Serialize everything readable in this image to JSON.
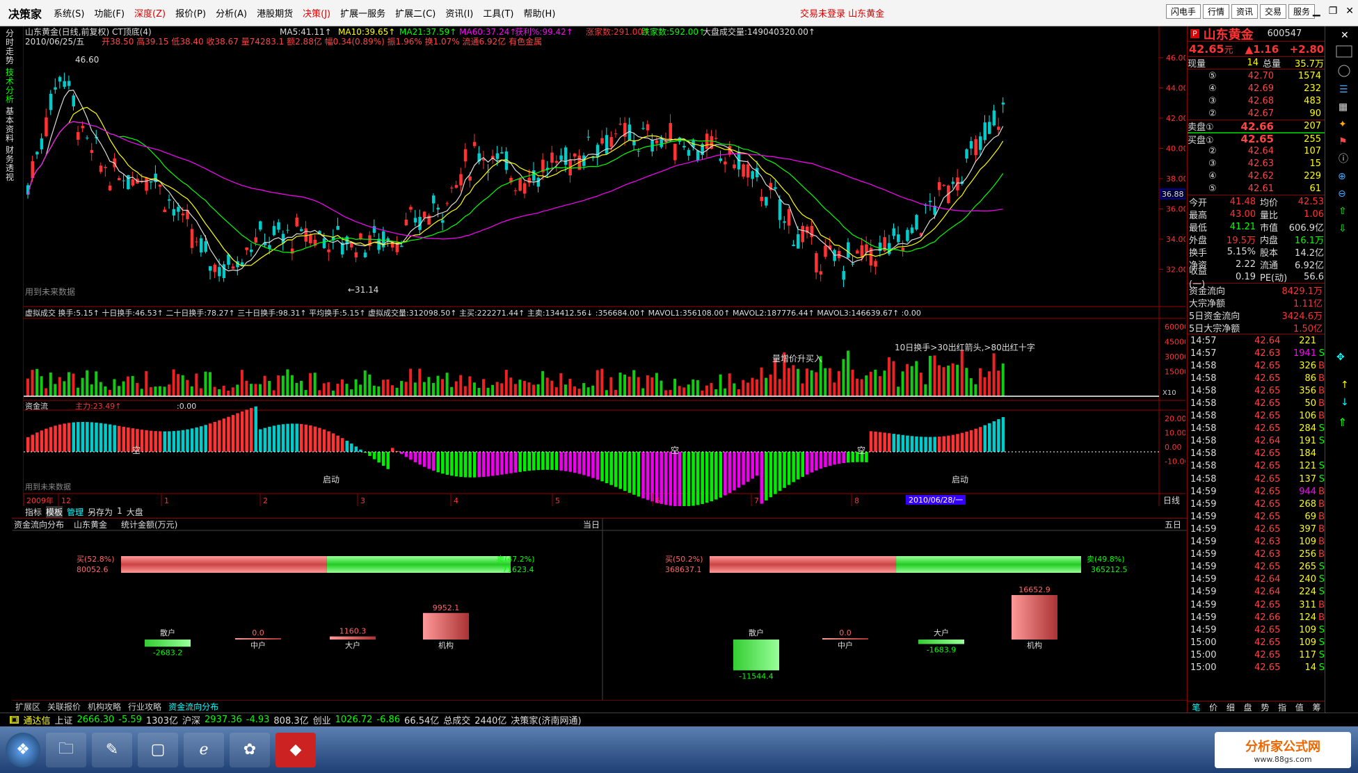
{
  "app": {
    "logo": "决策家",
    "menus": [
      "系统(S)",
      "功能(F)",
      "深度(Z)",
      "报价(P)",
      "分析(A)",
      "港股期货",
      "决策(J)",
      "扩展一服务",
      "扩展二(C)",
      "资讯(I)",
      "工具(T)",
      "帮助(H)"
    ],
    "login": "交易未登录  山东黄金",
    "top_buttons": [
      "闪电手",
      "行情",
      "资讯",
      "交易",
      "服务"
    ]
  },
  "left_tabs": [
    "分时走势",
    "技术分析",
    "基本资料",
    "财务透视"
  ],
  "main": {
    "title": "山东黄金(日线,前复权) CT顶底(4)",
    "date": "2010/06/25/五",
    "ohlc": "开38.50 高39.15 低38.40 收38.67 量74283.1 额2.88亿 幅0.34(0.89%) 振1.96% 换1.07% 流通6.92亿 有色金属",
    "ma5": "MA5:41.11↑",
    "ma10": "MA10:39.65↑",
    "ma21": "MA21:37.59↑",
    "ma60": "MA60:37.24↑",
    "profit": "获利%:99.42↑",
    "up": "涨家数:291.00↑",
    "down": "跌家数:592.00↑",
    "bigvol": "大盘成交量:149040320.00↑",
    "high_label": "46.60",
    "low_label": "←31.14",
    "future_note": "用到未来数据",
    "rsnote1": "36.88",
    "price_ticks": [
      "46.00",
      "44.00",
      "42.00",
      "40.00",
      "38.00",
      "36.00",
      "34.00",
      "32.00"
    ],
    "vol_line": "虚拟成交  换手:5.15↑  十日换手:46.53↑  二十日换手:78.27↑  三十日换手:98.31↑  平均换手:5.15↑  虚拟成交量:312098.50↑  主买:222271.44↑  主卖:134412.56↓  :356684.00↑  MAVOL1:356108.00↑  MAVOL2:187776.44↑  MAVOL3:146639.67↑  :0.00",
    "vol_note": "10日换手>30出红箭头,>80出红十字",
    "vol_note2": "量增价升买入",
    "vol_ticks": [
      "60000",
      "45000",
      "30000",
      "15000"
    ],
    "vol_x": "X10",
    "flow_title": "资金流",
    "flow_main": "主力:23.49↑",
    "flow_zero": ":0.00",
    "flow_ticks": [
      "20.00",
      "10.00",
      "0.00",
      "-10.00"
    ],
    "flow_labels": [
      "空",
      "空",
      "空",
      "启动",
      "启动"
    ],
    "xaxis": [
      "2009年",
      "12",
      "1",
      "2",
      "3",
      "4",
      "5",
      "6",
      "7",
      "8"
    ],
    "xaxis_date": "2010/06/28/一",
    "period": "日线",
    "bottom_tabs": [
      "指标",
      "模板",
      "管理",
      "另存为",
      "1",
      "大盘"
    ]
  },
  "flow_dist": {
    "title": "资金流向分布",
    "stock": "山东黄金",
    "unit": "统计金额(万元)",
    "today": "当日",
    "five": "五日",
    "today_buy_pct": "买(52.8%)",
    "today_buy": "80052.6",
    "today_sell_pct": "卖(47.2%)",
    "today_sell": "71623.4",
    "five_buy_pct": "买(50.2%)",
    "five_buy": "368637.1",
    "five_sell_pct": "卖(49.8%)",
    "five_sell": "365212.5",
    "cats": [
      "散户",
      "中户",
      "大户",
      "机构"
    ],
    "today_vals": [
      -2683.2,
      0.0,
      1160.3,
      9952.1
    ],
    "today_labels": [
      "-2683.2",
      "0.0",
      "1160.3",
      "9952.1"
    ],
    "five_vals": [
      -11544.4,
      0.0,
      -1683.9,
      16652.9
    ],
    "five_labels": [
      "-11544.4",
      "0.0",
      "-1683.9",
      "16652.9"
    ]
  },
  "bottom_links": [
    "扩展区",
    "关联报价",
    "机构攻略",
    "行业攻略",
    "资金流向分布"
  ],
  "quote": {
    "name": "山东黄金",
    "code": "600547",
    "price": "42.65",
    "unit": "元",
    "chg": "▲1.16",
    "chgpct": "+2.80",
    "now_vol_label": "现量",
    "now_vol": "14",
    "total_label": "总量",
    "total": "35.7万",
    "asks": [
      [
        "⑤",
        "42.70",
        "1574"
      ],
      [
        "④",
        "42.69",
        "232"
      ],
      [
        "③",
        "42.68",
        "483"
      ],
      [
        "②",
        "42.67",
        "90"
      ]
    ],
    "ask1": [
      "卖盘①",
      "42.66",
      "207"
    ],
    "bid1": [
      "买盘①",
      "42.65",
      "255"
    ],
    "bids": [
      [
        "②",
        "42.64",
        "107"
      ],
      [
        "③",
        "42.63",
        "15"
      ],
      [
        "④",
        "42.62",
        "229"
      ],
      [
        "⑤",
        "42.61",
        "61"
      ]
    ],
    "stats": [
      [
        "今开",
        "41.48",
        "均价",
        "42.53"
      ],
      [
        "最高",
        "43.00",
        "量比",
        "1.06"
      ],
      [
        "最低",
        "41.21",
        "市值",
        "606.9亿"
      ],
      [
        "外盘",
        "19.5万",
        "内盘",
        "16.1万"
      ],
      [
        "换手",
        "5.15%",
        "股本",
        "14.2亿"
      ],
      [
        "净资",
        "2.22",
        "流通",
        "6.92亿"
      ],
      [
        "收益(一)",
        "0.19",
        "PE(动)",
        "56.6"
      ]
    ],
    "fund": [
      [
        "资金流向",
        "8429.1万"
      ],
      [
        "大宗净额",
        "1.11亿"
      ],
      [
        "5日资金流向",
        "3424.6万"
      ],
      [
        "5日大宗净额",
        "1.50亿"
      ]
    ],
    "ticks": [
      [
        "14:57",
        "42.64",
        "221",
        ""
      ],
      [
        "14:57",
        "42.63",
        "1941",
        "S"
      ],
      [
        "14:58",
        "42.65",
        "326",
        "B"
      ],
      [
        "14:58",
        "42.65",
        "86",
        "B"
      ],
      [
        "14:58",
        "42.65",
        "356",
        "B"
      ],
      [
        "14:58",
        "42.65",
        "50",
        "B"
      ],
      [
        "14:58",
        "42.65",
        "106",
        "B"
      ],
      [
        "14:58",
        "42.65",
        "284",
        "S"
      ],
      [
        "14:58",
        "42.64",
        "191",
        "S"
      ],
      [
        "14:58",
        "42.65",
        "184",
        ""
      ],
      [
        "14:58",
        "42.65",
        "121",
        "S"
      ],
      [
        "14:58",
        "42.65",
        "137",
        "S"
      ],
      [
        "14:59",
        "42.65",
        "944",
        "B"
      ],
      [
        "14:59",
        "42.65",
        "268",
        "B"
      ],
      [
        "14:59",
        "42.65",
        "69",
        "B"
      ],
      [
        "14:59",
        "42.65",
        "397",
        "B"
      ],
      [
        "14:59",
        "42.63",
        "109",
        "B"
      ],
      [
        "14:59",
        "42.63",
        "256",
        "B"
      ],
      [
        "14:59",
        "42.65",
        "265",
        "S"
      ],
      [
        "14:59",
        "42.64",
        "240",
        "S"
      ],
      [
        "14:59",
        "42.64",
        "224",
        "S"
      ],
      [
        "14:59",
        "42.65",
        "311",
        "B"
      ],
      [
        "14:59",
        "42.66",
        "124",
        "B"
      ],
      [
        "14:59",
        "42.65",
        "109",
        "S"
      ],
      [
        "15:00",
        "42.65",
        "109",
        "S"
      ],
      [
        "15:00",
        "42.65",
        "117",
        "S"
      ],
      [
        "15:00",
        "42.65",
        "14",
        "S"
      ]
    ],
    "bottom_icons": [
      "笔",
      "价",
      "细",
      "盘",
      "势",
      "指",
      "值",
      "筹"
    ]
  },
  "status": {
    "brand": "通达信",
    "sh_label": "上证",
    "sh": "2666.30",
    "sh_chg": "-5.59",
    "sh_amt": "1303亿",
    "hs_label": "沪深",
    "hs": "2937.36",
    "hs_chg": "-4.93",
    "hs_amt": "808.3亿",
    "cy_label": "创业",
    "cy": "1026.72",
    "cy_chg": "-6.86",
    "cy_amt": "66.54亿",
    "total_label": "总成交",
    "total": "2440亿",
    "server": "决策家(济南网通)"
  },
  "watermark": "分析家公式网",
  "watermark_url": "www.88gs.com"
}
